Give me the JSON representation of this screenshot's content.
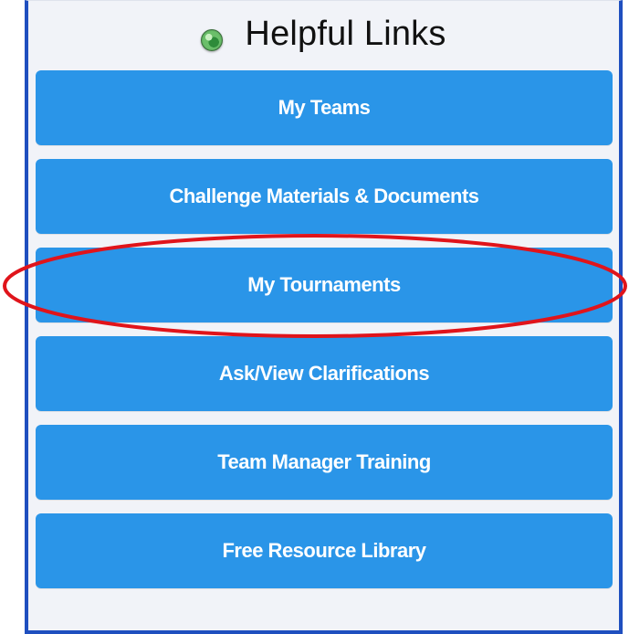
{
  "header": {
    "title": "Helpful Links",
    "icon": "globe-icon"
  },
  "links": [
    {
      "label": "My Teams"
    },
    {
      "label": "Challenge Materials & Documents"
    },
    {
      "label": "My Tournaments",
      "highlighted": true
    },
    {
      "label": "Ask/View Clarifications"
    },
    {
      "label": "Team Manager Training"
    },
    {
      "label": "Free Resource Library"
    }
  ],
  "colors": {
    "button": "#2a95e8",
    "panel_background": "#f1f3f8",
    "panel_border": "#1f4fbf",
    "annotation": "#e0141b"
  }
}
